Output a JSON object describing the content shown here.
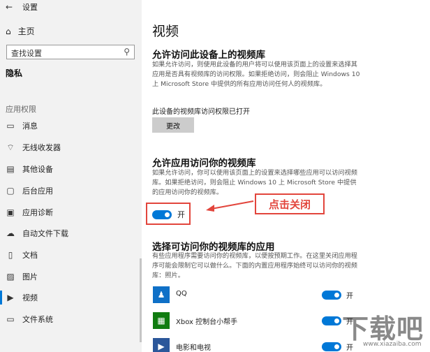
{
  "window": {
    "title": "设置"
  },
  "sidebar": {
    "home": "主页",
    "search_placeholder": "查找设置",
    "category": "隐私",
    "section": "应用权限",
    "items": [
      {
        "label": "消息",
        "icon": "message-icon"
      },
      {
        "label": "无线收发器",
        "icon": "radio-icon"
      },
      {
        "label": "其他设备",
        "icon": "devices-icon"
      },
      {
        "label": "后台应用",
        "icon": "background-apps-icon"
      },
      {
        "label": "应用诊断",
        "icon": "diagnostics-icon"
      },
      {
        "label": "自动文件下载",
        "icon": "cloud-download-icon"
      },
      {
        "label": "文档",
        "icon": "document-icon"
      },
      {
        "label": "图片",
        "icon": "picture-icon"
      },
      {
        "label": "视频",
        "icon": "video-icon"
      },
      {
        "label": "文件系统",
        "icon": "file-system-icon"
      }
    ]
  },
  "main": {
    "title": "视频",
    "device_access": {
      "heading": "允许访问此设备上的视频库",
      "description": "如果允许访问，则使用此设备的用户将可以使用该页面上的设置来选择其应用是否具有视频库的访问权限。如果拒绝访问，则会阻止 Windows 10 上 Microsoft Store 中提供的所有应用访问任何人的视频库。",
      "status": "此设备的视频库访问权限已打开",
      "change_button": "更改"
    },
    "app_access": {
      "heading": "允许应用访问你的视频库",
      "description": "如果允许访问，你可以使用该页面上的设置来选择哪些应用可以访问视频库。如果拒绝访问，则会阻止 Windows 10 上 Microsoft Store 中提供的应用访问你的视频库。",
      "toggle_label": "开"
    },
    "callout": "点击关闭",
    "choose_apps": {
      "heading": "选择可访问你的视频库的应用",
      "description": "有些应用程序需要访问你的视频库，以便按预期工作。在这里关闭应用程序可能会限制它可以做什么。下面的内置应用程序始终可以访问你的视频库：照片。",
      "apps": [
        {
          "name": "QQ",
          "state": "开",
          "icon": "qq-icon"
        },
        {
          "name": "Xbox 控制台小帮手",
          "state": "开",
          "icon": "xbox-icon"
        },
        {
          "name": "电影和电视",
          "state": "开",
          "icon": "movie-icon"
        }
      ]
    }
  },
  "watermark": {
    "main": "下载吧",
    "sub": "www.xiazaiba.com"
  },
  "colors": {
    "accent": "#0078d7",
    "annotation": "#e2453c",
    "sidebar_bg": "#f2f2f2"
  }
}
